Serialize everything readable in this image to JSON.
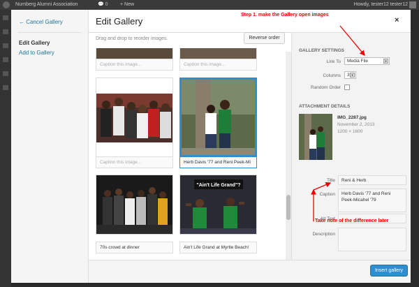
{
  "admin_bar": {
    "site_name": "Nurnberg Alumni Association",
    "comments_count": "0",
    "new_label": "New",
    "howdy": "Howdy, tester12 tester12"
  },
  "left_pane": {
    "cancel_label": "← Cancel Gallery",
    "edit_gallery": "Edit Gallery",
    "add_to_gallery": "Add to Gallery"
  },
  "header": {
    "title": "Edit Gallery",
    "close_label": "×"
  },
  "toolbar": {
    "drag_text": "Drag and drop to reorder images.",
    "reverse_label": "Reverse order"
  },
  "tiles": [
    {
      "caption": "Caption this image...",
      "filled": false
    },
    {
      "caption": "Caption this image...",
      "filled": false
    },
    {
      "caption": "Caption this image...",
      "filled": false
    },
    {
      "caption": "Herb Davis '77 and Reni Peek-Mi",
      "filled": true
    },
    {
      "caption": "70s crowd at dinner",
      "filled": true
    },
    {
      "caption": "Ain't Life Grand at Myrtle Beach!",
      "filled": true
    }
  ],
  "tile_sign_text": "\"Ain't Life Grand\"?",
  "gallery_settings": {
    "heading": "GALLERY SETTINGS",
    "link_to_label": "Link To",
    "link_to_value": "Media File",
    "columns_label": "Columns",
    "columns_value": "3",
    "random_label": "Random Order"
  },
  "attachment": {
    "heading": "ATTACHMENT DETAILS",
    "filename": "IMG_2287.jpg",
    "date": "November 2, 2013",
    "dimensions": "1200 × 1600",
    "title_label": "Title",
    "title_value": "Reni & Herb",
    "caption_label": "Caption",
    "caption_value": "Herb Davis '77 and Reni Peek-Micahel '79",
    "alt_label": "Alt Text",
    "description_label": "Description"
  },
  "annotations": {
    "step1": "Step 1. make the Gallery open images",
    "note": "Take note of the difference later"
  },
  "footer": {
    "insert_label": "Insert gallery"
  },
  "colors": {
    "accent": "#2e8ecf",
    "annotation": "#ee0000"
  }
}
